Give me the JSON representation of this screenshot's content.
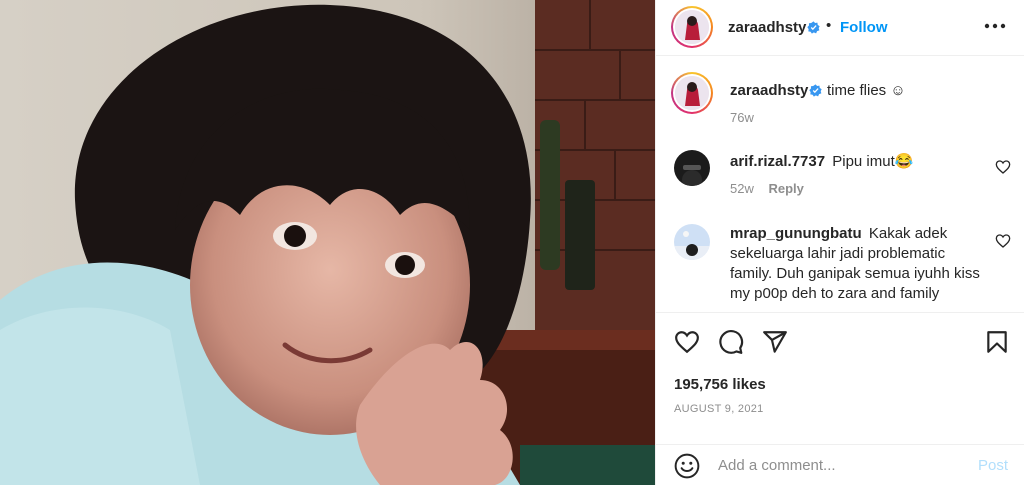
{
  "photo": {
    "alt": "post photo"
  },
  "header": {
    "username": "zaraadhsty",
    "separator": "•",
    "follow_label": "Follow"
  },
  "caption": {
    "username": "zaraadhsty",
    "text": "time flies ☺",
    "time": "76w"
  },
  "comments": [
    {
      "username": "arif.rizal.7737",
      "text": "Pipu imut😂",
      "time": "52w",
      "reply_label": "Reply"
    },
    {
      "username": "mrap_gunungbatu",
      "text": "Kakak adek sekeluarga lahir jadi problematic family. Duh ganipak semua iyuhh kiss my p00p deh to zara and family"
    }
  ],
  "actions": {
    "likes": "195,756 likes",
    "date": "AUGUST 9, 2021"
  },
  "add_comment": {
    "placeholder": "Add a comment...",
    "post_label": "Post"
  },
  "colors": {
    "accent": "#0095f6",
    "post_disabled": "#b2dffc",
    "muted": "#8e8e8e",
    "text": "#262626"
  },
  "icons": [
    "verified-badge-icon",
    "more-options-icon",
    "heart-icon",
    "comment-icon",
    "share-icon",
    "bookmark-icon",
    "emoji-icon"
  ]
}
